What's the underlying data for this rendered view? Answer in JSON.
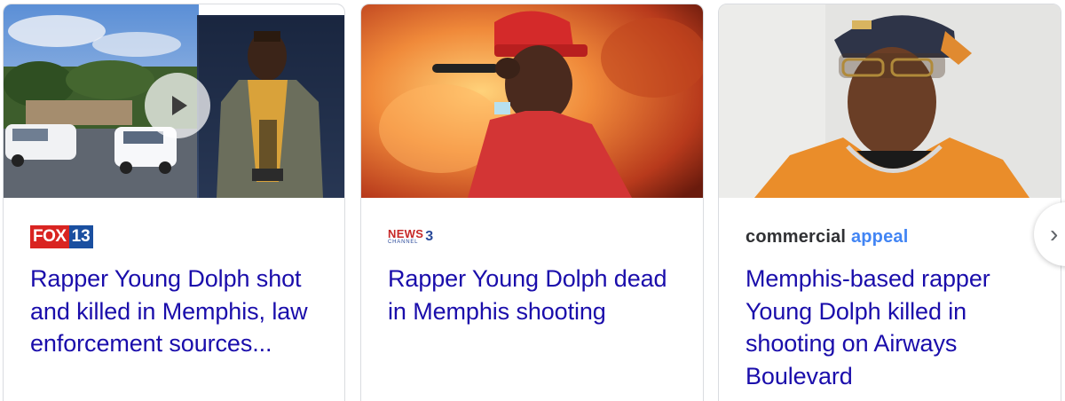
{
  "cards": [
    {
      "source": {
        "name": "FOX 13",
        "logo_part1": "FOX",
        "logo_part2": "13",
        "colors": {
          "fox": "#d92421",
          "num": "#1a4fa0"
        }
      },
      "headline": "Rapper Young Dolph shot and killed in Memphis, law enforcement sources...",
      "thumbnail": "police-cars-and-rapper-photo",
      "has_video": true,
      "play_icon": "play-icon"
    },
    {
      "source": {
        "name": "NEWS Channel 3",
        "logo_part1": "NEWS",
        "logo_part2": "CHANNEL",
        "logo_part3": "3"
      },
      "headline": "Rapper Young Dolph dead in Memphis shooting",
      "thumbnail": "rapper-performing-with-microphone"
    },
    {
      "source": {
        "name": "commercial appeal",
        "logo_part1": "commercial",
        "logo_part2": "appeal",
        "colors": {
          "a": "#303134",
          "b": "#4285f4"
        }
      },
      "headline": "Memphis-based rapper Young Dolph killed in shooting on Airways Boulevard",
      "thumbnail": "rapper-portrait-with-cap"
    }
  ],
  "next_button": {
    "icon": "chevron-right-icon",
    "glyph": "›"
  },
  "colors": {
    "headline": "#1a0dab",
    "border": "#dadce0"
  }
}
